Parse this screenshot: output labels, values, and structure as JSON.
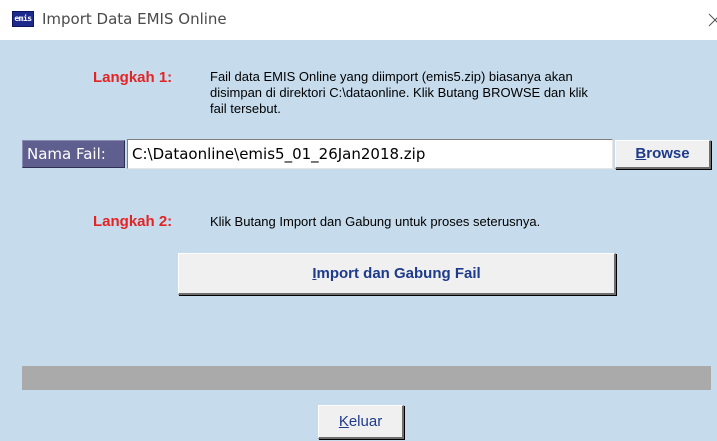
{
  "window": {
    "title": "Import Data EMIS Online",
    "icon_text": "emis"
  },
  "step1": {
    "label": "Langkah 1:",
    "text_line1": "Fail data EMIS Online yang diimport (emis5.zip) biasanya akan",
    "text_line2": "disimpan di direktori C:\\dataonline. Klik Butang BROWSE dan klik",
    "text_line3": "fail tersebut."
  },
  "file": {
    "label": "Nama Fail:",
    "value": "C:\\Dataonline\\emis5_01_26Jan2018.zip",
    "browse_label_first": "B",
    "browse_label_rest": "rowse"
  },
  "step2": {
    "label": "Langkah 2:",
    "text": "Klik Butang Import dan Gabung untuk proses seterusnya."
  },
  "import_button": {
    "label_first": "I",
    "label_rest": "mport dan Gabung Fail"
  },
  "progress": {
    "value_percent": 0
  },
  "exit_button": {
    "label_first": "K",
    "label_rest": "eluar"
  },
  "colors": {
    "client_background": "#c6dced",
    "step_label": "#e32424",
    "button_text": "#1e3a8a",
    "progress_track": "#aaaaaa"
  },
  "icons": {
    "app": "emis-app-icon",
    "close": "close-icon"
  }
}
